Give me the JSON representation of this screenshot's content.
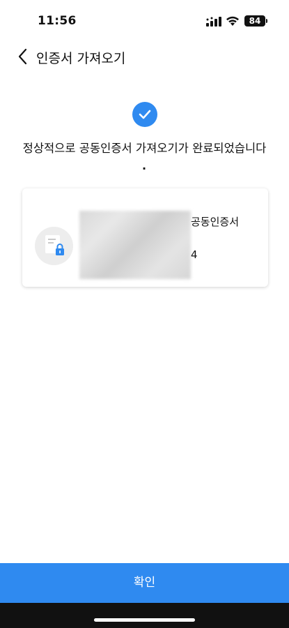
{
  "status_bar": {
    "time": "11:56",
    "battery": "84",
    "icons": [
      "signal-icon",
      "wifi-icon",
      "battery-icon"
    ]
  },
  "nav": {
    "title": "인증서 가져오기",
    "back_icon": "chevron-left-icon"
  },
  "result": {
    "icon": "check-circle-icon",
    "accent_color": "#2f8af0",
    "message": "정상적으로 공동인증서 가져오기가 완료되었습니다",
    "trailing_dot": "."
  },
  "certificate": {
    "icon": "document-lock-icon",
    "type": "공동인증서",
    "date_fragment": "4"
  },
  "footer": {
    "confirm_label": "확인"
  }
}
